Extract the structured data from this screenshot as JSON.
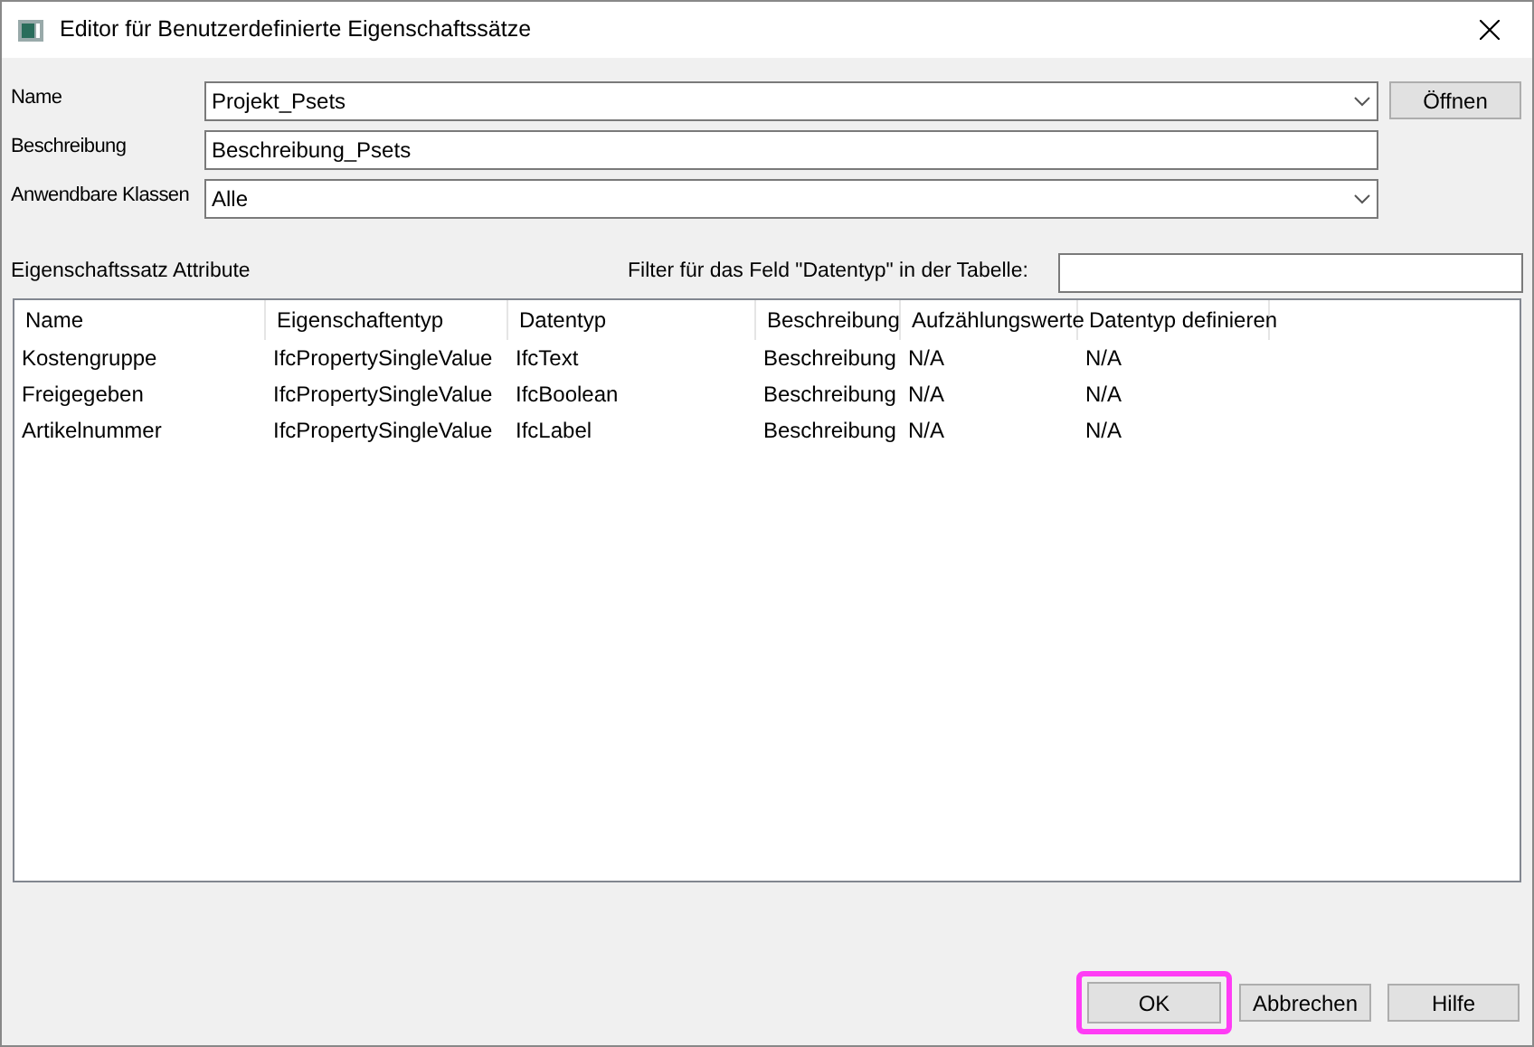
{
  "window": {
    "title": "Editor für Benutzerdefinierte Eigenschaftssätze"
  },
  "fields": [
    {
      "label": "Name",
      "value": "Projekt_Psets",
      "kind": "dropdown"
    },
    {
      "label": "Beschreibung",
      "value": "Beschreibung_Psets",
      "kind": "text"
    },
    {
      "label": "Anwendbare Klassen",
      "value": "Alle",
      "kind": "dropdown"
    }
  ],
  "open_button": "Öffnen",
  "attributes_label": "Eigenschaftssatz Attribute",
  "filter": {
    "label": "Filter für das Feld \"Datentyp\" in der Tabelle:"
  },
  "table": {
    "columns": [
      "Name",
      "Eigenschaftentyp",
      "Datentyp",
      "Beschreibung",
      "Aufzählungswerte",
      "Datentyp definieren"
    ],
    "rows": [
      [
        "Kostengruppe",
        "IfcPropertySingleValue",
        "IfcText",
        "Beschreibung",
        "N/A",
        "N/A"
      ],
      [
        "Freigegeben",
        "IfcPropertySingleValue",
        "IfcBoolean",
        "Beschreibung",
        "N/A",
        "N/A"
      ],
      [
        "Artikelnummer",
        "IfcPropertySingleValue",
        "IfcLabel",
        "Beschreibung",
        "N/A",
        "N/A"
      ]
    ]
  },
  "buttons": [
    {
      "label": "OK",
      "highlighted": true
    },
    {
      "label": "Abbrechen",
      "highlighted": false
    },
    {
      "label": "Hilfe",
      "highlighted": false
    }
  ]
}
